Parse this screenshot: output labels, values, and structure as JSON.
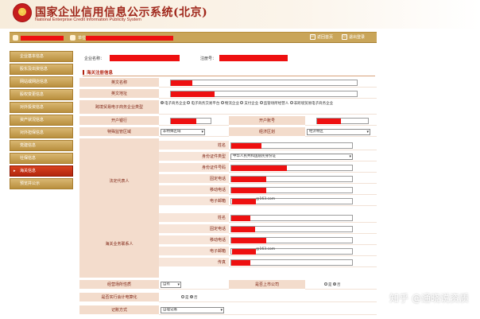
{
  "header": {
    "title_cn": "国家企业信用信息公示系统(北京)",
    "title_en": "National Enterprise Credit Information Publicity System",
    "emblem_icon": "national-emblem-icon"
  },
  "toolbar": {
    "user_label": "",
    "company_label": "单位",
    "return_label": "返回首页",
    "logout_label": "退出登录"
  },
  "sidebar": {
    "items": [
      {
        "label": "企业基本信息",
        "active": false
      },
      {
        "label": "股东及出资信息",
        "active": false
      },
      {
        "label": "网站或网店信息",
        "active": false
      },
      {
        "label": "股权变更信息",
        "active": false
      },
      {
        "label": "对外投资信息",
        "active": false
      },
      {
        "label": "资产状况信息",
        "active": false
      },
      {
        "label": "对外担保信息",
        "active": false
      },
      {
        "label": "党建信息",
        "active": false
      },
      {
        "label": "社保信息",
        "active": false
      },
      {
        "label": "海关信息",
        "active": true
      },
      {
        "label": "预览并公示",
        "active": false
      }
    ]
  },
  "main": {
    "company_name_label": "企业名称：",
    "reg_no_label": "注册号：",
    "section_title": "海关注册信息",
    "rows": {
      "english_name": "英文名称",
      "english_address": "英文地址",
      "cross_border_type": "跨境贸易电子商务企业类型",
      "bank": "开户银行",
      "account": "开户账号",
      "special_area": "特殊监管区域",
      "economic_zone": "经济区划",
      "contact_name": "姓名",
      "id_type": "身份证件类型",
      "id_number": "身份证件号码",
      "fixed_phone": "固定电话",
      "mobile": "移动电话",
      "email": "电子邮箱",
      "fax": "传真",
      "business_nature": "经营场所性质",
      "listed": "是否上市公司",
      "accounting": "是否实行会计电算化",
      "bookkeeping": "记账方式"
    },
    "cross_border_options": [
      "电子商务企业",
      "电子商务交易平台",
      "物流企业",
      "支付企业",
      "监管场所经营人",
      "非跨境贸易电子商务企业"
    ],
    "special_area_value": "非特殊区域",
    "economic_zone_value": "经济特区",
    "id_type_value": "中华人民共和国居民身份证",
    "email_domain_1": "@163.com",
    "email_domain_2": "@163.com",
    "legal_rep_label": "法定代表人",
    "customs_contact_label": "海关业务联系人",
    "business_nature_value": "自有",
    "yes": "是",
    "no": "否",
    "bookkeeping_value": "自理记账"
  },
  "watermark": "知乎 @通晓说资质",
  "colors": {
    "brand_red": "#a0281c",
    "toolbar_gold": "#c9a559",
    "active_red": "#c83217",
    "label_bg": "#f3dccc",
    "redaction": "#ee1010"
  }
}
